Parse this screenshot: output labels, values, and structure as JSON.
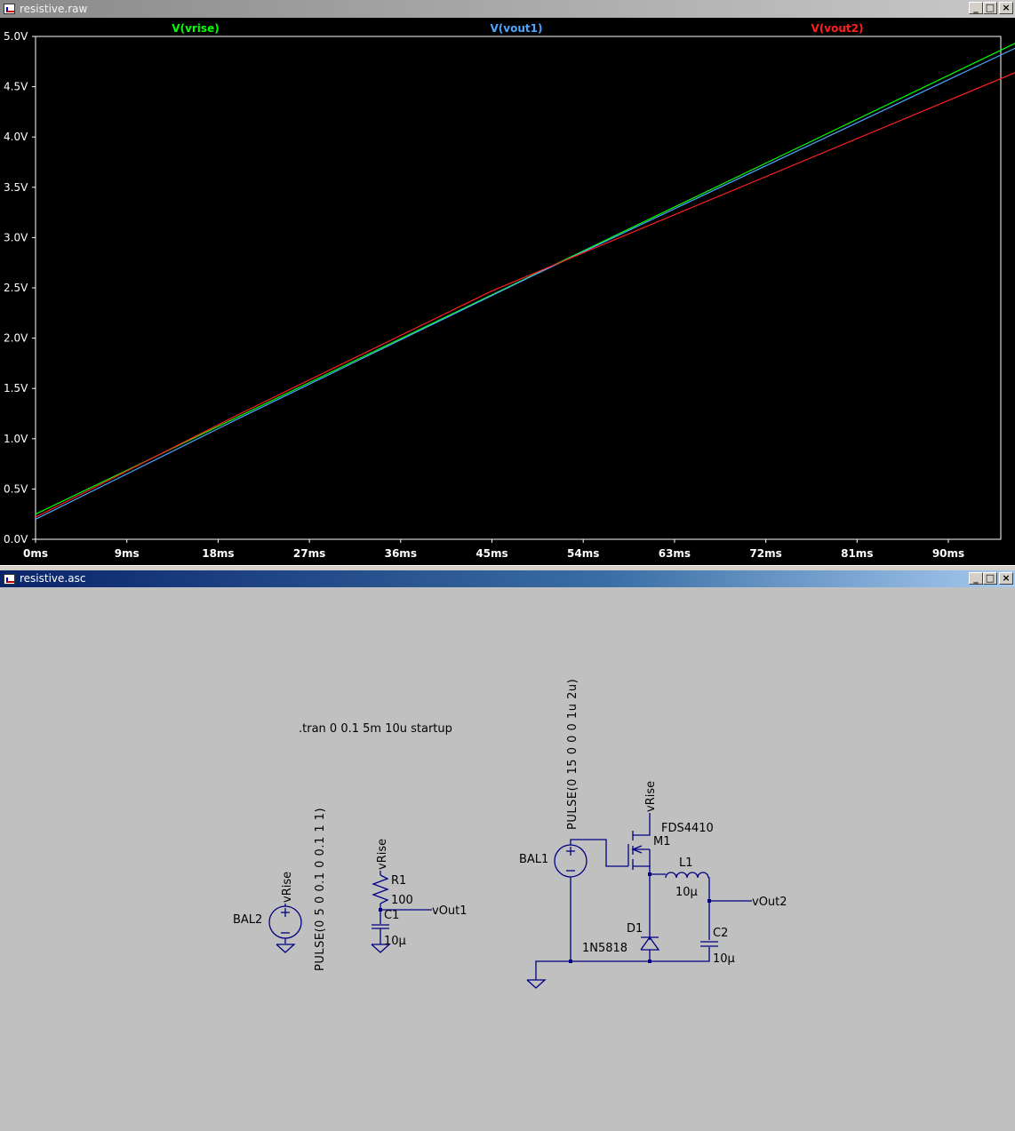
{
  "plot_window": {
    "title": "resistive.raw",
    "buttons": [
      "_",
      "□",
      "×"
    ]
  },
  "chart_data": {
    "type": "line",
    "x_unit": "ms",
    "x_range": [
      0,
      98
    ],
    "y_range": [
      0,
      5
    ],
    "x_ticks": [
      0,
      9,
      18,
      27,
      36,
      45,
      54,
      63,
      72,
      81,
      90
    ],
    "x_tick_labels": [
      "0ms",
      "9ms",
      "18ms",
      "27ms",
      "36ms",
      "45ms",
      "54ms",
      "63ms",
      "72ms",
      "81ms",
      "90ms"
    ],
    "y_ticks": [
      0,
      0.5,
      1,
      1.5,
      2,
      2.5,
      3,
      3.5,
      4,
      4.5,
      5
    ],
    "y_tick_labels": [
      "0.0V",
      "0.5V",
      "1.0V",
      "1.5V",
      "2.0V",
      "2.5V",
      "3.0V",
      "3.5V",
      "4.0V",
      "4.5V",
      "5.0V"
    ],
    "series": [
      {
        "name": "V(vrise)",
        "color": "#00ff00",
        "x": [
          0,
          98
        ],
        "y": [
          0.25,
          5.0
        ]
      },
      {
        "name": "V(vout1)",
        "color": "#4da6ff",
        "x": [
          0,
          20,
          49,
          98
        ],
        "y": [
          0.2,
          1.2,
          2.62,
          4.95
        ]
      },
      {
        "name": "V(vout2)",
        "color": "#ff1f1f",
        "x": [
          0,
          20,
          45,
          98
        ],
        "y": [
          0.22,
          1.24,
          2.47,
          4.7
        ]
      }
    ],
    "background": "#000000",
    "grid": false
  },
  "schematic_window": {
    "title": "resistive.asc",
    "buttons": [
      "_",
      "□",
      "×"
    ],
    "directive": ".tran 0 0.1 5m 10u startup",
    "components": {
      "bal2": {
        "name": "BAL2",
        "value": "PULSE(0 5 0 0.1 0 0.1 1 1)",
        "net": "vRise"
      },
      "r1": {
        "name": "R1",
        "value": "100",
        "net": "vRise"
      },
      "c1": {
        "name": "C1",
        "value": "10µ",
        "net": "vOut1"
      },
      "bal1": {
        "name": "BAL1",
        "value": "PULSE(0 15 0 0 0 1u 2u)"
      },
      "m1": {
        "name": "M1",
        "value": "FDS4410",
        "net": "vRise"
      },
      "l1": {
        "name": "L1",
        "value": "10µ"
      },
      "d1": {
        "name": "D1",
        "value": "1N5818"
      },
      "c2": {
        "name": "C2",
        "value": "10µ",
        "net": "vOut2"
      }
    }
  }
}
